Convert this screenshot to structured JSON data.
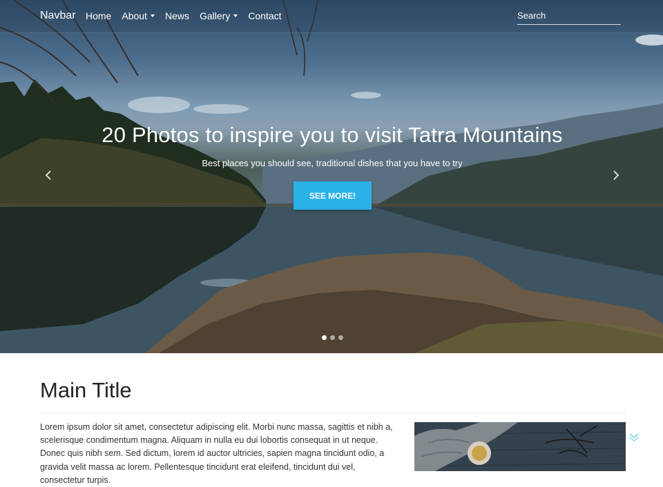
{
  "navbar": {
    "brand": "Navbar",
    "links": [
      {
        "label": "Home",
        "dropdown": false
      },
      {
        "label": "About",
        "dropdown": true
      },
      {
        "label": "News",
        "dropdown": false
      },
      {
        "label": "Gallery",
        "dropdown": true
      },
      {
        "label": "Contact",
        "dropdown": false
      }
    ],
    "search_placeholder": "Search"
  },
  "hero": {
    "title": "20 Photos to inspire you to visit Tatra Mountains",
    "subtitle": "Best places you should see, traditional dishes that you have to try",
    "cta_label": "SEE MORE!",
    "slides_total": 3,
    "active_slide": 1,
    "icons": [
      "chevron-left-icon",
      "chevron-right-icon"
    ]
  },
  "content": {
    "title": "Main Title",
    "paragraph": "Lorem ipsum dolor sit amet, consectetur adipiscing elit. Morbi nunc massa, sagittis et nibh a, scelerisque condimentum magna. Aliquam in nulla eu dui lobortis consequat in ut neque. Donec quis nibh sem. Sed dictum, lorem id auctor ultricies, sapien magna tincidunt odio, a gravida velit massa ac lorem. Pellentesque tincidunt erat eleifend, tincidunt dui vel, consectetur turpis."
  },
  "colors": {
    "accent": "#29b2e8",
    "scroll_icon": "#7fd0ee"
  }
}
